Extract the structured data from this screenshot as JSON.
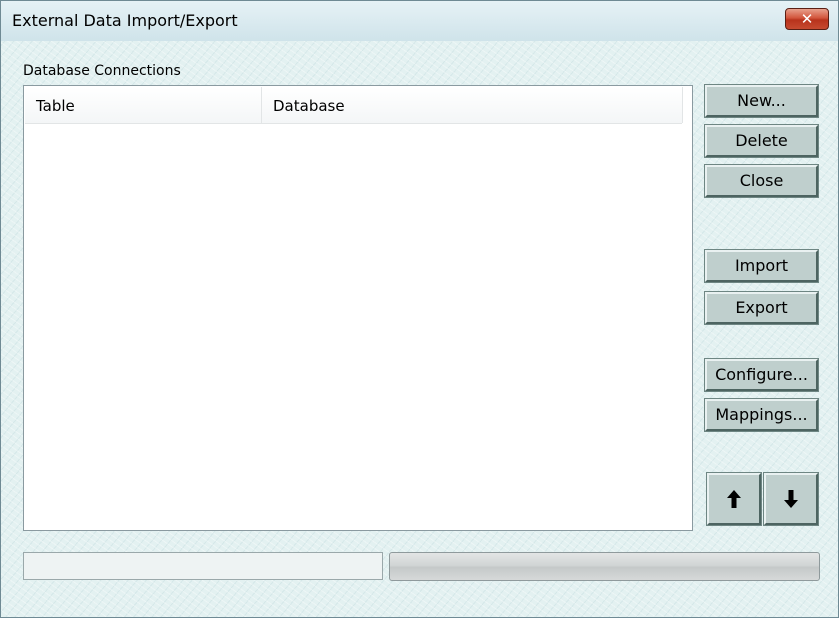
{
  "window": {
    "title": "External Data Import/Export",
    "close_glyph": "✕"
  },
  "connections": {
    "label": "Database Connections",
    "columns": [
      "Table",
      "Database"
    ],
    "rows": []
  },
  "buttons": {
    "new": "New...",
    "delete": "Delete",
    "close": "Close",
    "import": "Import",
    "export": "Export",
    "configure": "Configure...",
    "mappings": "Mappings...",
    "move_up": "🡅",
    "move_down": "🡇"
  },
  "status": {
    "text": "",
    "progress": 0
  }
}
